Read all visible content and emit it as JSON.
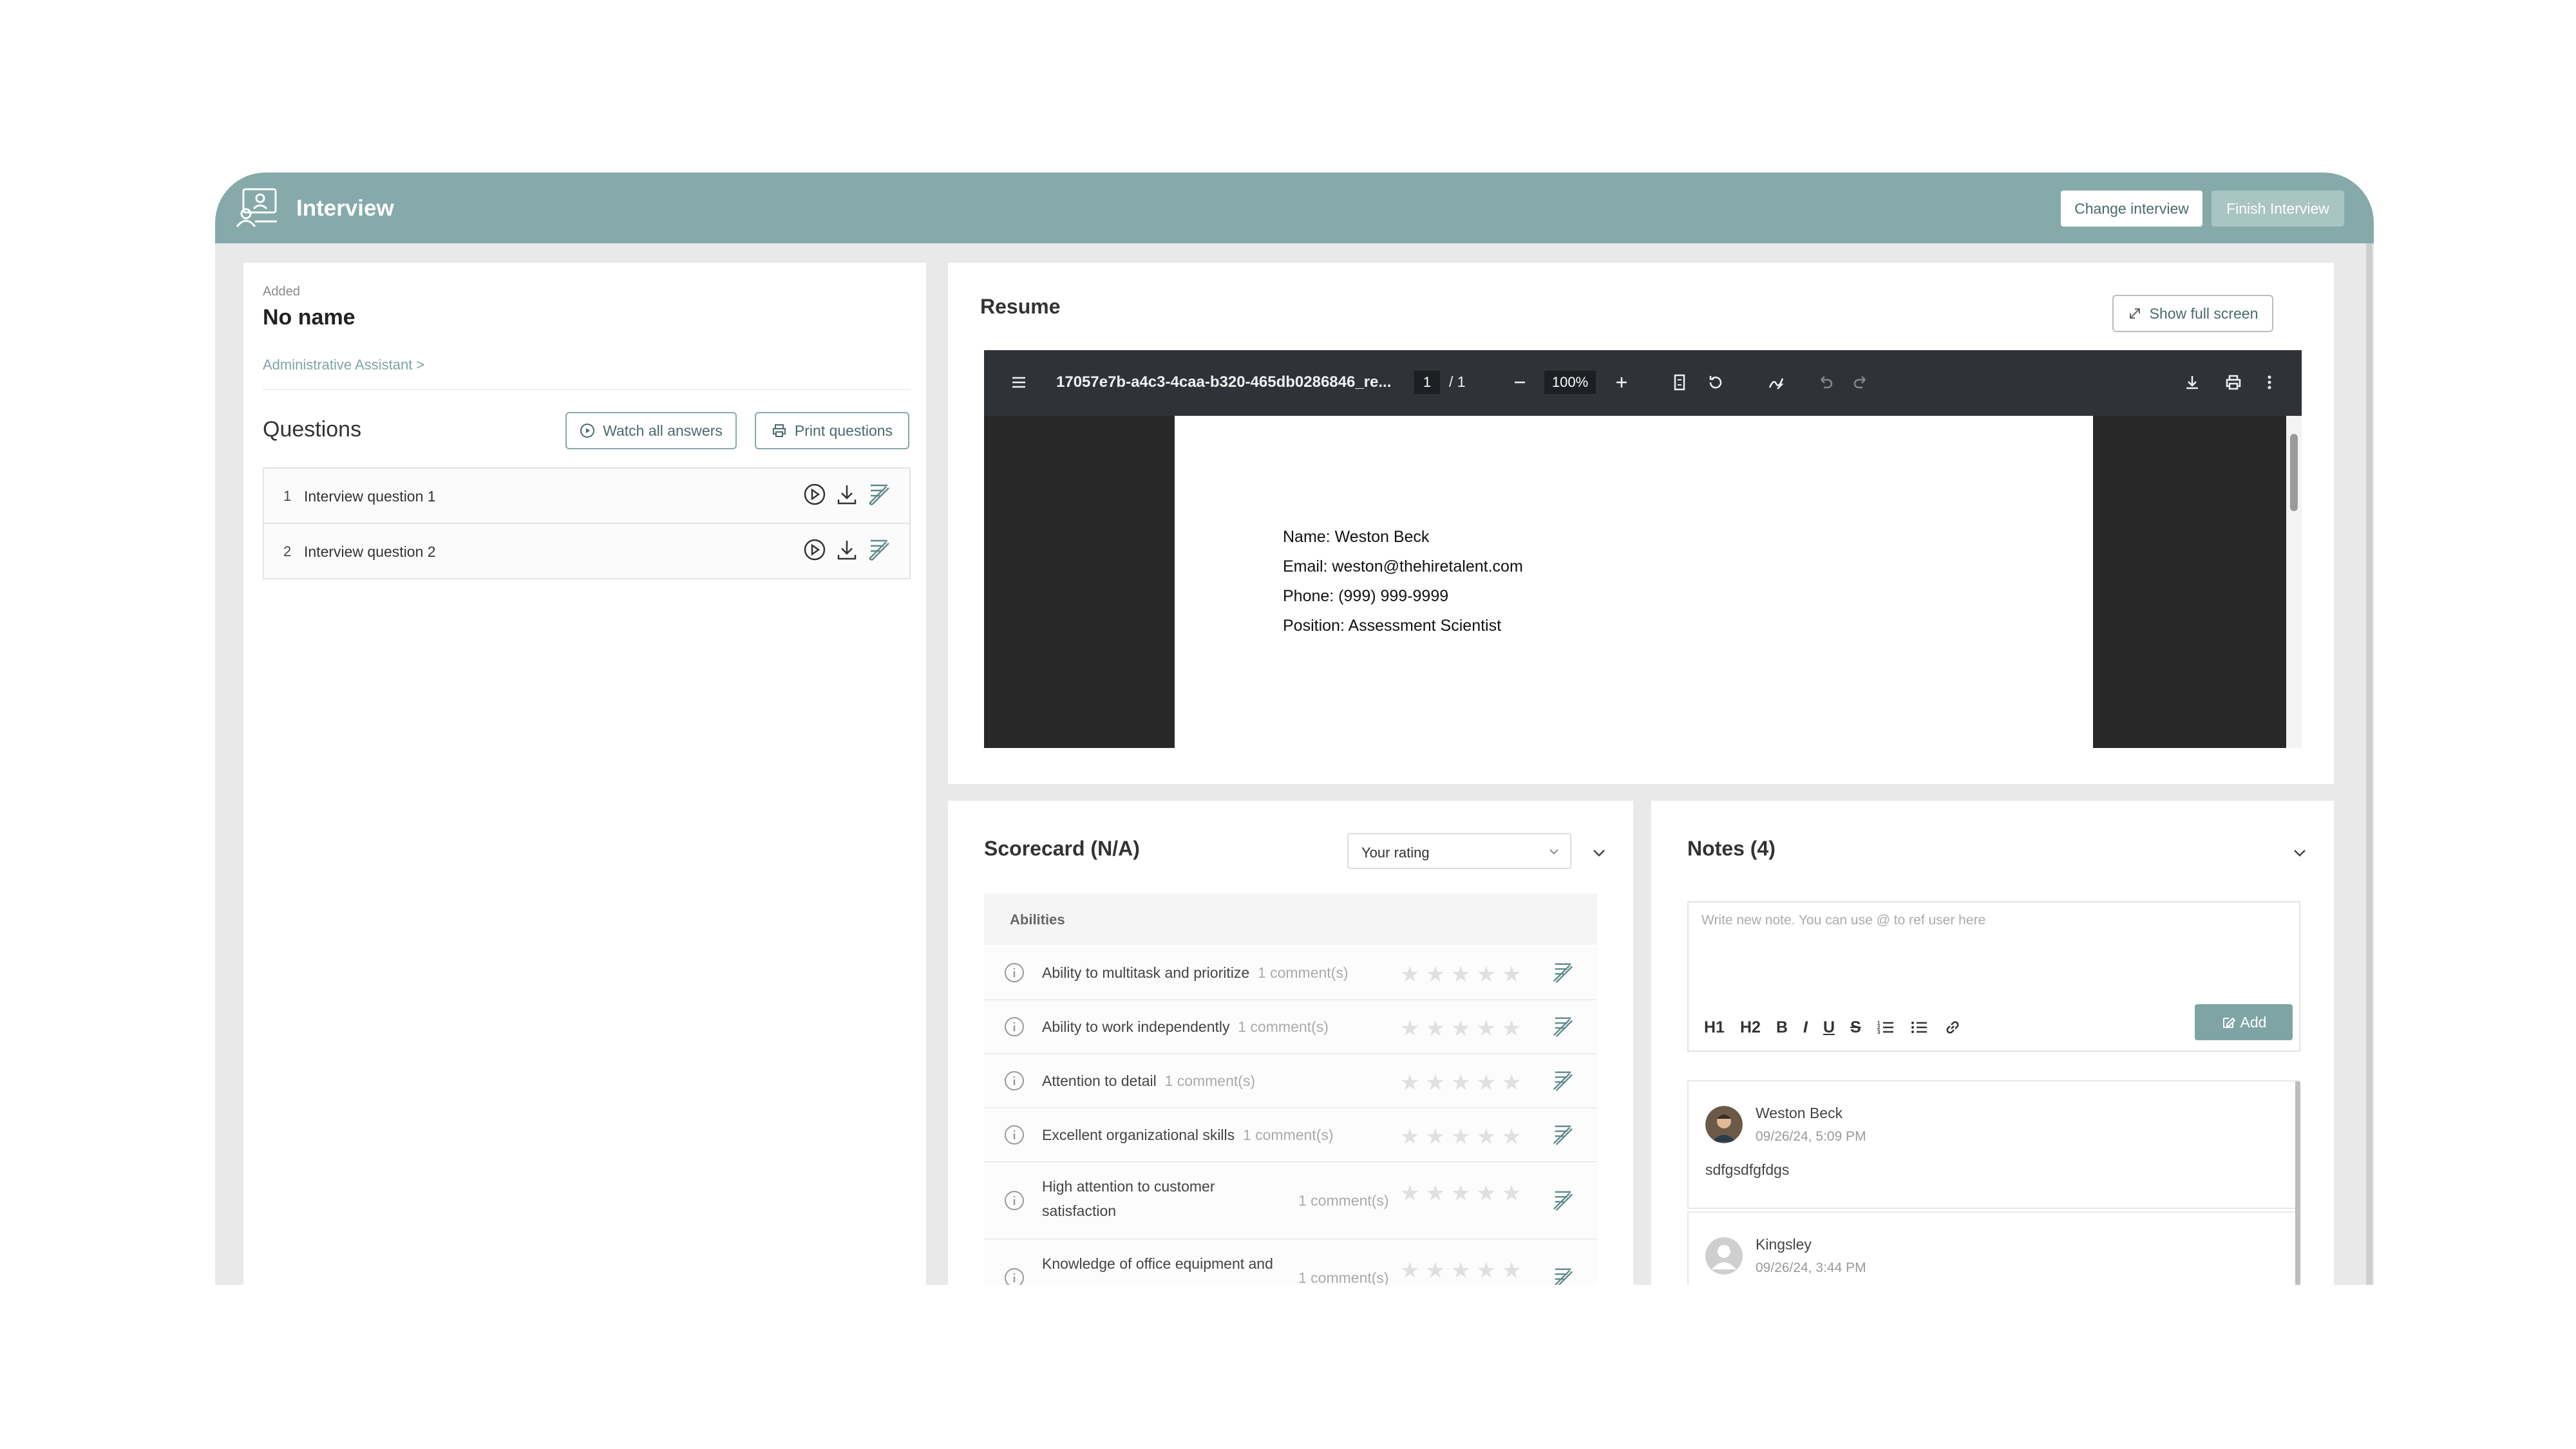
{
  "header": {
    "title": "Interview",
    "change_button": "Change interview",
    "finish_button": "Finish Interview"
  },
  "candidate": {
    "added_label": "Added",
    "name": "No name",
    "breadcrumb": "Administrative Assistant >"
  },
  "questions": {
    "title": "Questions",
    "watch_all": "Watch all answers",
    "print": "Print questions",
    "items": [
      {
        "num": "1",
        "text": "Interview question 1"
      },
      {
        "num": "2",
        "text": "Interview question 2"
      }
    ]
  },
  "resume": {
    "title": "Resume",
    "full_screen": "Show full screen",
    "pdf": {
      "filename": "17057e7b-a4c3-4caa-b320-465db0286846_re...",
      "page": "1",
      "page_total": "/ 1",
      "zoom": "100%",
      "lines": [
        "Name: Weston Beck",
        "Email: weston@thehiretalent.com",
        "Phone: (999) 999-9999",
        "Position: Assessment Scientist"
      ]
    }
  },
  "scorecard": {
    "title": "Scorecard (N/A)",
    "rating_placeholder": "Your rating",
    "section": "Abilities",
    "items": [
      {
        "text": "Ability to multitask and prioritize",
        "comments": "1 comment(s)"
      },
      {
        "text": "Ability to work independently",
        "comments": "1 comment(s)"
      },
      {
        "text": "Attention to detail",
        "comments": "1 comment(s)"
      },
      {
        "text": "Excellent organizational skills",
        "comments": "1 comment(s)"
      },
      {
        "text_line1": "High attention to customer",
        "text_line2": "satisfaction",
        "comments": "1 comment(s)"
      },
      {
        "text_line1": "Knowledge of office equipment and",
        "comments": "1 comment(s)"
      }
    ],
    "stars": "★★★★★"
  },
  "notes": {
    "title": "Notes (4)",
    "placeholder": "Write new note. You can use @ to ref user here",
    "add_button": "Add",
    "tools": [
      "H1",
      "H2",
      "B",
      "I",
      "U",
      "S"
    ],
    "items": [
      {
        "author": "Weston Beck",
        "time": "09/26/24, 5:09 PM",
        "body": "sdfgsdfgfdgs"
      },
      {
        "author": "Kingsley",
        "time": "09/26/24, 3:44 PM"
      }
    ]
  }
}
